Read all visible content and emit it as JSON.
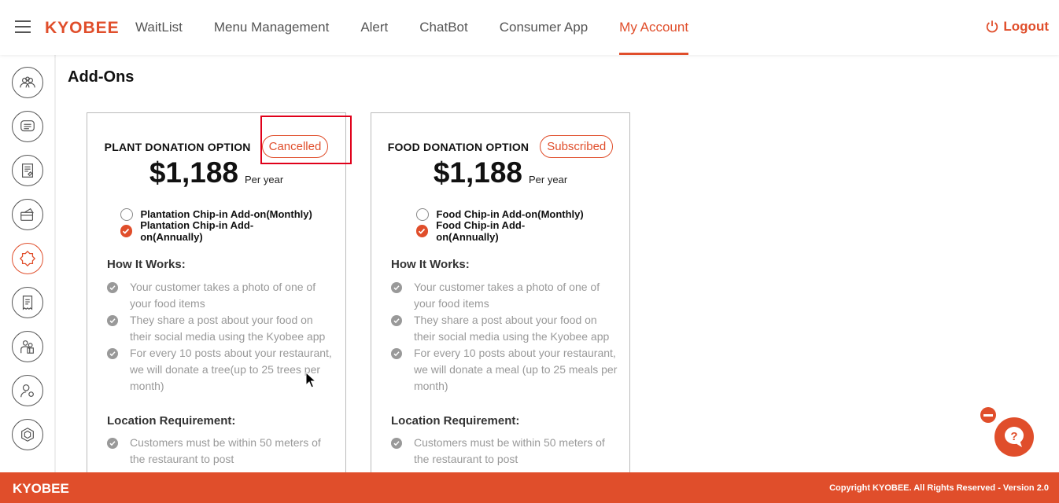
{
  "brand": "KYOBEE",
  "nav": {
    "items": [
      "WaitList",
      "Menu Management",
      "Alert",
      "ChatBot",
      "Consumer App",
      "My Account"
    ],
    "active": "My Account",
    "logout": "Logout"
  },
  "sidebar": {
    "icons": [
      "users-icon",
      "chat-icon",
      "menu-doc-icon",
      "payment-icon",
      "badge-icon",
      "receipt-icon",
      "family-icon",
      "user-settings-icon",
      "hexagon-icon"
    ],
    "active_index": 4
  },
  "page_title": "Add-Ons",
  "cards": [
    {
      "name": "PLANT DONATION OPTION",
      "status": "Cancelled",
      "price": "$1,188",
      "per": "Per year",
      "options": [
        {
          "label": "Plantation Chip-in Add-on(Monthly)",
          "checked": false
        },
        {
          "label": "Plantation Chip-in Add-on(Annually)",
          "checked": true
        }
      ],
      "how_title": "How It Works:",
      "how_items": [
        "Your customer takes a photo of one of your food items",
        "They share a post about your food on their social media using the Kyobee app",
        "For every 10 posts about your restaurant, we will donate a tree(up to 25 trees per month)"
      ],
      "loc_title": "Location Requirement:",
      "loc_items": [
        "Customers must be within 50 meters of the restaurant to post"
      ]
    },
    {
      "name": "FOOD DONATION OPTION",
      "status": "Subscribed",
      "price": "$1,188",
      "per": "Per year",
      "options": [
        {
          "label": "Food Chip-in Add-on(Monthly)",
          "checked": false
        },
        {
          "label": "Food Chip-in Add-on(Annually)",
          "checked": true
        }
      ],
      "how_title": "How It Works:",
      "how_items": [
        "Your customer takes a photo of one of your food items",
        "They share a post about your food on their social media using the Kyobee app",
        "For every 10 posts about your restaurant, we will donate a meal (up to 25 meals per month)"
      ],
      "loc_title": "Location Requirement:",
      "loc_items": [
        "Customers must be within 50 meters of the restaurant to post"
      ]
    }
  ],
  "footer": {
    "brand": "KYOBEE",
    "copyright": "Copyright KYOBEE. All Rights Reserved - Version 2.0"
  },
  "colors": {
    "accent": "#e04e2b",
    "highlight": "#e0001a",
    "muted": "#999999"
  }
}
